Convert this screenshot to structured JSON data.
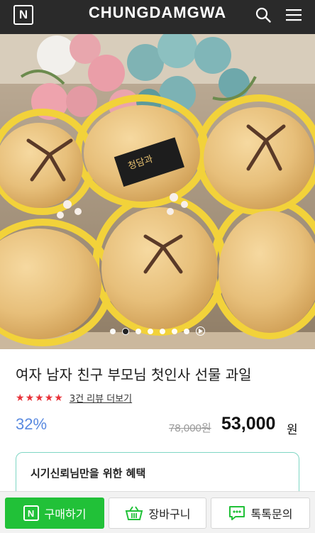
{
  "header": {
    "badge_letter": "N",
    "brand": "CHUNGDAMGWA",
    "search_icon": "search-icon",
    "menu_icon": "hamburger-menu-icon",
    "background": "#2a2a2a"
  },
  "hero": {
    "card_text": "청담과",
    "carousel": {
      "total_dots": 7,
      "active_index": 1
    }
  },
  "product": {
    "title": "여자 남자 친구 부모님 첫인사 선물 과일",
    "rating": {
      "stars": 5,
      "review_link": "3건 리뷰 더보기"
    },
    "discount": "32%",
    "original_price": "78,000원",
    "price": "53,000",
    "price_unit": "원"
  },
  "benefit": {
    "title": "시기신뢰님만을 위한 혜택"
  },
  "bottom_bar": {
    "buy": {
      "label": "구매하기",
      "badge": "N",
      "color": "#21c138"
    },
    "cart": {
      "label": "장바구니",
      "icon": "basket-icon"
    },
    "talk": {
      "label": "톡톡문의",
      "icon": "chat-bubble-icon"
    }
  }
}
